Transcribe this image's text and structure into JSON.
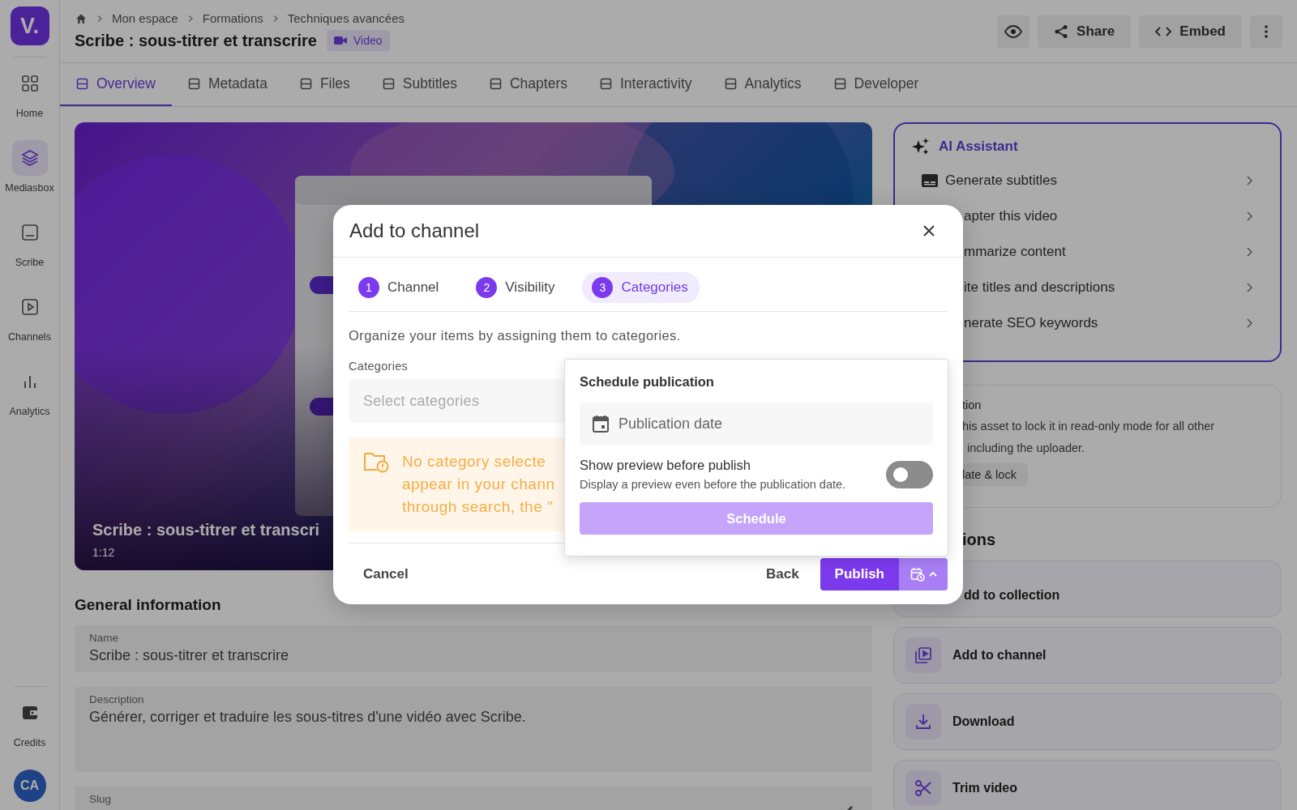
{
  "sidebar": {
    "logo": "V.",
    "items": [
      {
        "label": "Home",
        "selected": false
      },
      {
        "label": "Mediasbox",
        "selected": true
      },
      {
        "label": "Scribe",
        "selected": false
      },
      {
        "label": "Channels",
        "selected": false
      },
      {
        "label": "Analytics",
        "selected": false
      }
    ],
    "bottom_item": "Credits",
    "avatar": "CA"
  },
  "header": {
    "breadcrumbs": [
      "Mon espace",
      "Formations",
      "Techniques avancées"
    ],
    "title": "Scribe : sous-titrer et transcrire",
    "badge": "Video",
    "actions": [
      "Share",
      "Embed"
    ]
  },
  "tabs": [
    {
      "label": "Overview",
      "selected": true
    },
    {
      "label": "Metadata",
      "selected": false
    },
    {
      "label": "Files",
      "selected": false
    },
    {
      "label": "Subtitles",
      "selected": false
    },
    {
      "label": "Chapters",
      "selected": false
    },
    {
      "label": "Interactivity",
      "selected": false
    },
    {
      "label": "Analytics",
      "selected": false
    },
    {
      "label": "Developer",
      "selected": false
    }
  ],
  "video": {
    "title": "Scribe : sous-titrer et transcri",
    "duration": "1:12"
  },
  "general": {
    "heading": "General information",
    "fields": [
      {
        "label": "Name",
        "value": "Scribe : sous-titrer et transcrire"
      },
      {
        "label": "Description",
        "value": "Générer, corriger et traduire les sous-titres d'une vidéo avec Scribe."
      },
      {
        "label": "Slug"
      }
    ]
  },
  "ai": {
    "title": "AI Assistant",
    "items": [
      "Generate subtitles",
      "apter this video",
      "mmarize content",
      "ite titles and descriptions",
      "nerate SEO keywords"
    ]
  },
  "lock_card": {
    "title": "tion",
    "lines": [
      "his asset to lock it in read-only mode for all other",
      "including the uploader."
    ],
    "button": "late & lock"
  },
  "actions": {
    "heading": "ions",
    "items": [
      "dd to collection",
      "Add to channel",
      "Download",
      "Trim video"
    ]
  },
  "modal": {
    "title": "Add to channel",
    "steps": [
      {
        "number": "1",
        "label": "Channel",
        "selected": false
      },
      {
        "number": "2",
        "label": "Visibility",
        "selected": false
      },
      {
        "number": "3",
        "label": "Categories",
        "selected": true
      }
    ],
    "description": "Organize your items by assigning them to categories.",
    "field_label": "Categories",
    "placeholder": "Select categories",
    "warning_lines": [
      "No category selecte",
      "appear in your chann",
      "through search, the \""
    ],
    "cancel": "Cancel",
    "back": "Back",
    "publish": "Publish"
  },
  "popover": {
    "title": "Schedule publication",
    "date_placeholder": "Publication date",
    "toggle_label": "Show preview before publish",
    "toggle_hint": "Display a preview even before the publication date.",
    "toggle_on": false,
    "button": "Schedule"
  }
}
